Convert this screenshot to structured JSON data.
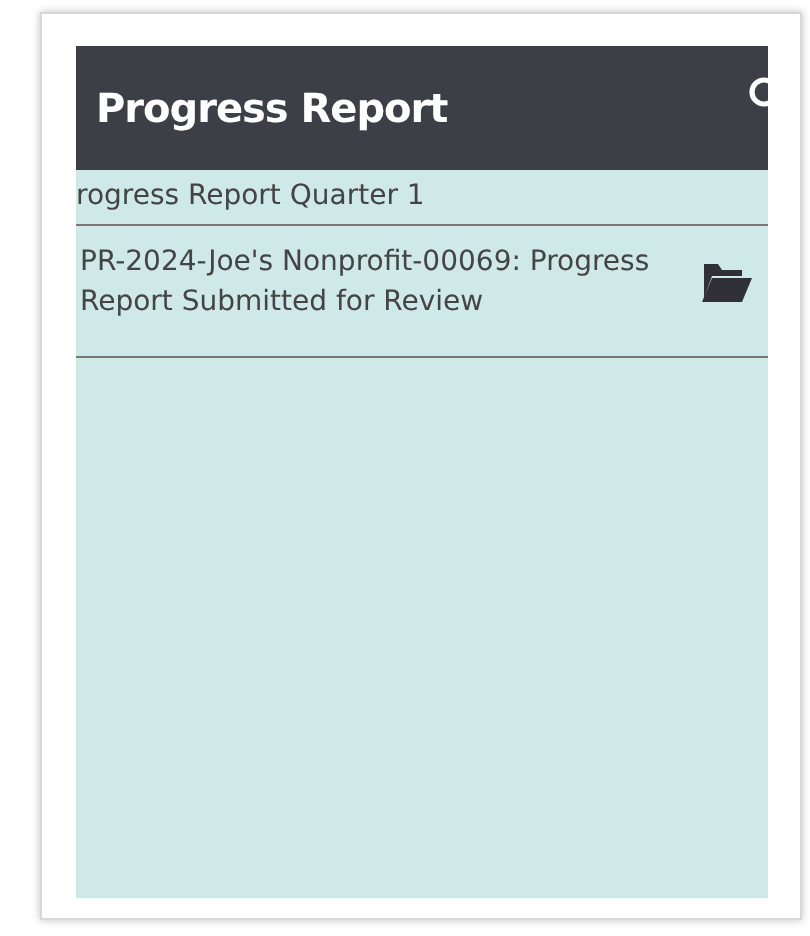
{
  "header": {
    "title": "Progress Report"
  },
  "group": {
    "label": "rogress Report Quarter 1"
  },
  "items": [
    {
      "text": "PR-2024-Joe's Nonprofit-00069: Progress Report Submitted for Review"
    }
  ]
}
